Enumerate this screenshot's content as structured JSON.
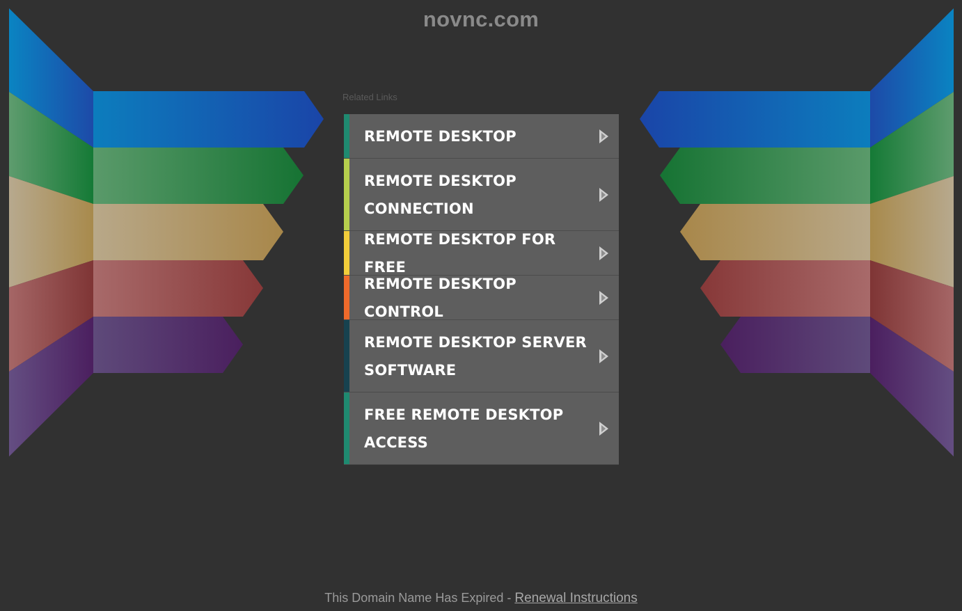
{
  "header": {
    "domain": "novnc.com"
  },
  "related": {
    "label": "Related Links",
    "links": [
      {
        "label": "REMOTE DESKTOP",
        "accent": "#1f8a70"
      },
      {
        "label": "REMOTE DESKTOP CONNECTION",
        "accent": "#b6cf4d"
      },
      {
        "label": "REMOTE DESKTOP FOR FREE",
        "accent": "#f2cd3a"
      },
      {
        "label": "REMOTE DESKTOP CONTROL",
        "accent": "#ef6a2b"
      },
      {
        "label": "REMOTE DESKTOP SERVER SOFTWARE",
        "accent": "#17424f"
      },
      {
        "label": "FREE REMOTE DESKTOP ACCESS",
        "accent": "#1f8a70"
      }
    ],
    "arrow_icon": "play-arrow-icon"
  },
  "footer": {
    "text": "This Domain Name Has Expired - ",
    "link": "Renewal Instructions"
  },
  "decor": {
    "ribbon_colors": {
      "blue": [
        "#0c7dbd",
        "#1a45a8"
      ],
      "green": [
        "#5a9a6a",
        "#167333"
      ],
      "tan": [
        "#b8a889",
        "#a8874a"
      ],
      "red": [
        "#a86a6a",
        "#873838"
      ],
      "purple": [
        "#5e4a7a",
        "#4a1f5e"
      ]
    }
  }
}
